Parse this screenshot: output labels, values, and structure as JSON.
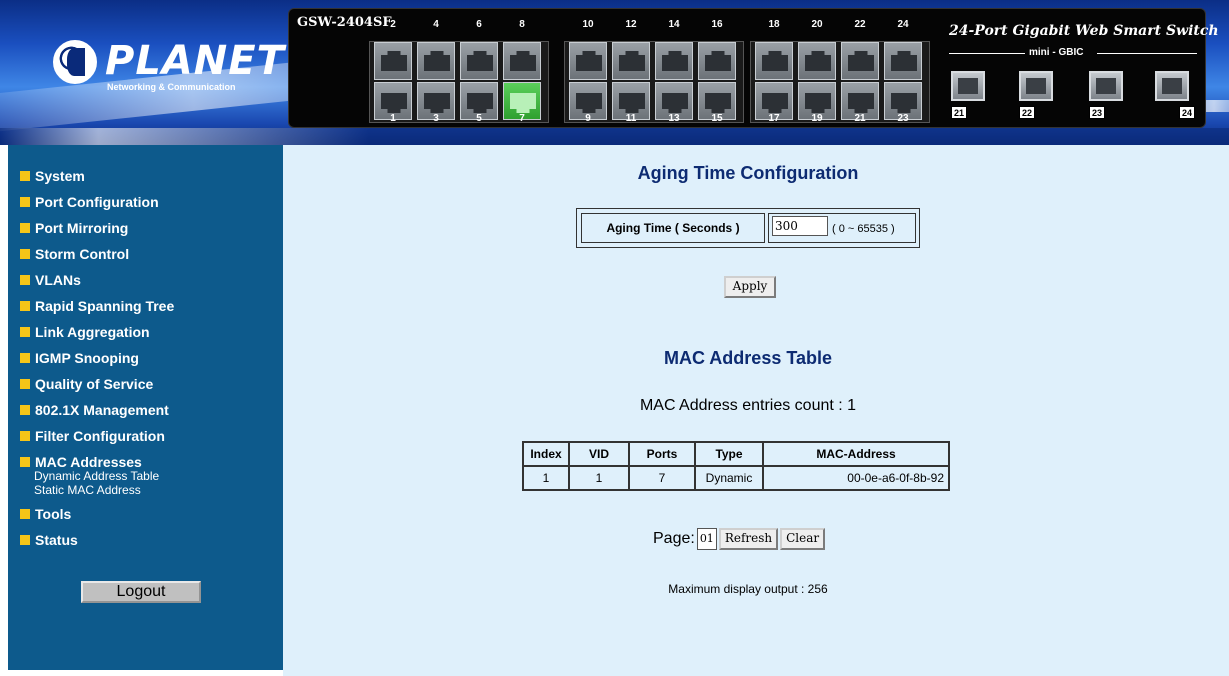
{
  "header": {
    "logo_text": "PLANET",
    "logo_tagline": "Networking & Communication",
    "model": "GSW-2404SF",
    "device_title": "24-Port Gigabit Web Smart Switch",
    "gbic_label": "mini - GBIC",
    "top_port_numbers": [
      "2",
      "4",
      "6",
      "8",
      "10",
      "12",
      "14",
      "16",
      "18",
      "20",
      "22",
      "24"
    ],
    "bottom_port_numbers": [
      "1",
      "3",
      "5",
      "7",
      "9",
      "11",
      "13",
      "15",
      "17",
      "19",
      "21",
      "23"
    ],
    "sfp_numbers": [
      "21",
      "22",
      "23",
      "24"
    ],
    "active_port": "7"
  },
  "sidebar": {
    "items": [
      {
        "label": "System"
      },
      {
        "label": "Port Configuration"
      },
      {
        "label": "Port Mirroring"
      },
      {
        "label": "Storm Control"
      },
      {
        "label": "VLANs"
      },
      {
        "label": "Rapid Spanning Tree"
      },
      {
        "label": "Link Aggregation"
      },
      {
        "label": "IGMP Snooping"
      },
      {
        "label": "Quality of Service"
      },
      {
        "label": "802.1X Management"
      },
      {
        "label": "Filter Configuration"
      },
      {
        "label": "MAC Addresses",
        "subitems": [
          "Dynamic Address Table",
          "Static MAC Address"
        ]
      },
      {
        "label": "Tools"
      },
      {
        "label": "Status"
      }
    ],
    "logout_label": "Logout"
  },
  "aging": {
    "title": "Aging Time Configuration",
    "label": "Aging Time ( Seconds )",
    "value": "300",
    "range": "( 0 ~ 65535 )",
    "apply_label": "Apply"
  },
  "mac_table": {
    "title": "MAC Address Table",
    "count_text": "MAC Address entries count : 1",
    "columns": [
      "Index",
      "VID",
      "Ports",
      "Type",
      "MAC-Address"
    ],
    "rows": [
      [
        "1",
        "1",
        "7",
        "Dynamic",
        "00-0e-a6-0f-8b-92"
      ]
    ],
    "page_label": "Page:",
    "page_value": "01",
    "refresh_label": "Refresh",
    "clear_label": "Clear",
    "max_output": "Maximum display output : 256"
  },
  "colors": {
    "sidebar_bg": "#0d5a8c",
    "content_bg": "#dff0fb",
    "bullet": "#f5c518",
    "title": "#0d2b72",
    "active_port": "#2fa02f"
  }
}
